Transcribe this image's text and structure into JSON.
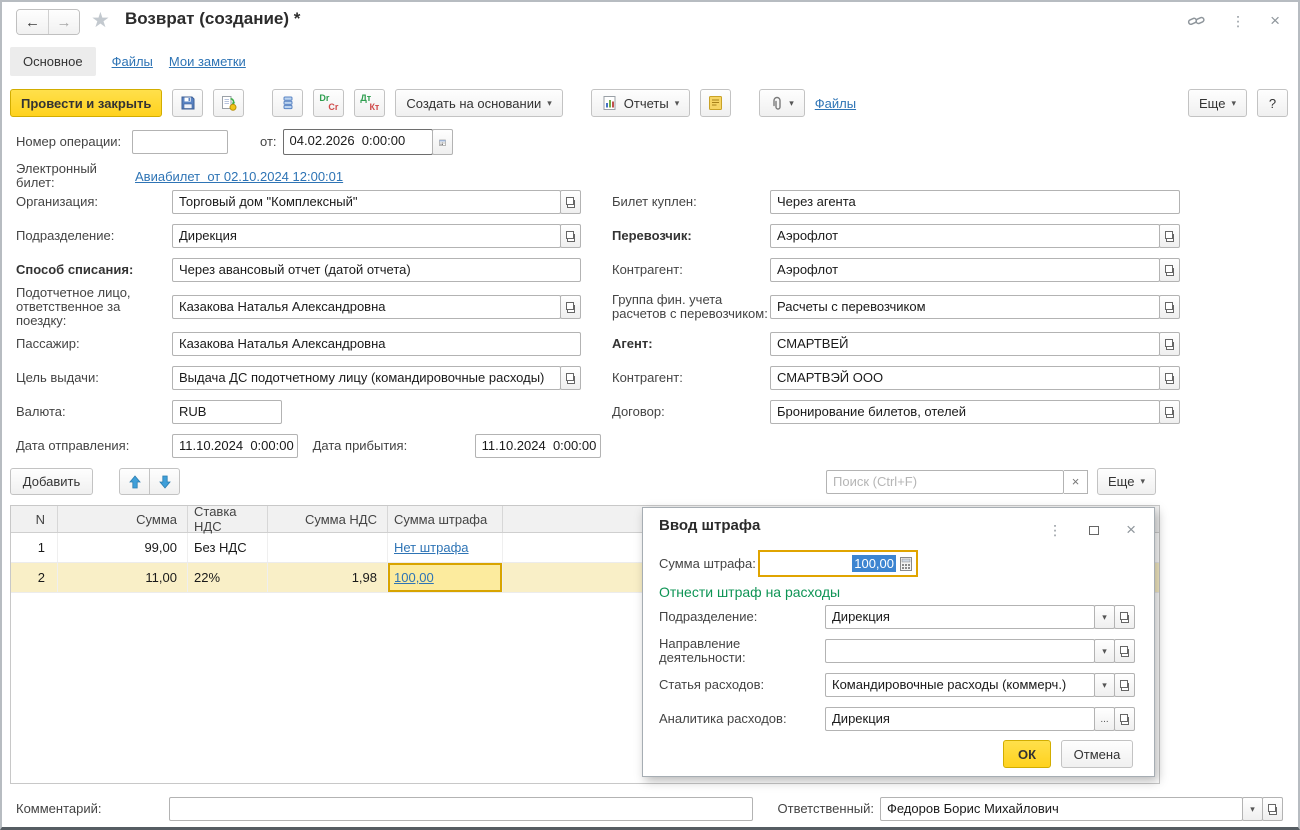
{
  "palette": {
    "accent_yellow": "#ffd21e",
    "link_blue": "#2e74b5",
    "selected_row": "#f9efc7",
    "active_cell_border": "#d8a400",
    "section_green": "#0e9455",
    "selection_blue": "#3d85d1"
  },
  "icons": {
    "back-icon": "←",
    "forward-icon": "→",
    "favorite-icon": "★",
    "link-chain-icon": "css-svg",
    "more-dots-icon": "⋮",
    "close-icon": "×",
    "save-icon": "floppy-svg",
    "post-document-icon": "doc-arrow-svg",
    "register-icon": "stack-svg",
    "reports-icon": "chart-svg",
    "note-icon": "yellow-doc-svg",
    "attach-icon": "paperclip-svg",
    "calendar-icon": "calendar-svg",
    "calculator-icon": "calc-svg",
    "chevron-down-icon": "▾",
    "open-icon": "two-squares",
    "arrow-up-icon": "blue-arrow-svg",
    "arrow-down-icon": "blue-arrow-svg",
    "maximize-icon": "square",
    "clear-icon": "×"
  },
  "header": {
    "title": "Возврат (создание) *"
  },
  "tabs": {
    "main": "Основное",
    "files": "Файлы",
    "notes": "Мои заметки"
  },
  "toolbar": {
    "post_and_close": "Провести и закрыть",
    "dr": "Dr",
    "cr": "Cr",
    "dt": "Дт",
    "kt": "Кт",
    "create_on_basis": "Создать на основании",
    "reports": "Отчеты",
    "files_link": "Файлы",
    "more": "Еще",
    "help": "?"
  },
  "doc": {
    "number_label": "Номер операции:",
    "number_value": "",
    "date_label": "от:",
    "date_value": "04.02.2026  0:00:00",
    "eticket_label": "Электронный билет:",
    "eticket_link": "Авиабилет  от 02.10.2024 12:00:01"
  },
  "form_left": {
    "org": {
      "label": "Организация:",
      "value": "Торговый дом \"Комплексный\""
    },
    "division": {
      "label": "Подразделение:",
      "value": "Дирекция"
    },
    "writeoff": {
      "label": "Способ списания:",
      "value": "Через авансовый отчет (датой отчета)"
    },
    "person": {
      "label": "Подотчетное лицо, ответственное за поездку:",
      "value": "Казакова Наталья Александровна"
    },
    "passenger": {
      "label": "Пассажир:",
      "value": "Казакова Наталья Александровна"
    },
    "purpose": {
      "label": "Цель выдачи:",
      "value": "Выдача ДС подотчетному лицу (командировочные расходы)"
    },
    "currency": {
      "label": "Валюта:",
      "value": "RUB"
    },
    "depart": {
      "label": "Дата отправления:",
      "value": "11.10.2024  0:00:00"
    },
    "arrive": {
      "label": "Дата прибытия:",
      "value": "11.10.2024  0:00:00"
    }
  },
  "form_right": {
    "bought": {
      "label": "Билет куплен:",
      "value": "Через агента"
    },
    "carrier": {
      "label": "Перевозчик:",
      "value": "Аэрофлот"
    },
    "carrier_contractor": {
      "label": "Контрагент:",
      "value": "Аэрофлот"
    },
    "fin_group": {
      "label": "Группа фин. учета расчетов с перевозчиком:",
      "value": "Расчеты с перевозчиком"
    },
    "agent": {
      "label": "Агент:",
      "value": "СМАРТВЕЙ"
    },
    "agent_contractor": {
      "label": "Контрагент:",
      "value": "СМАРТВЭЙ ООО"
    },
    "contract": {
      "label": "Договор:",
      "value": "Бронирование билетов, отелей"
    }
  },
  "table": {
    "add_button": "Добавить",
    "search_placeholder": "Поиск (Ctrl+F)",
    "more_button": "Еще",
    "headers": [
      "N",
      "Сумма",
      "Ставка НДС",
      "Сумма НДС",
      "Сумма штрафа",
      ""
    ],
    "rows": [
      {
        "n": "1",
        "sum": "99,00",
        "vat_rate": "Без НДС",
        "vat_sum": "",
        "penalty": "Нет штрафа"
      },
      {
        "n": "2",
        "sum": "11,00",
        "vat_rate": "22%",
        "vat_sum": "1,98",
        "penalty": "100,00"
      }
    ]
  },
  "dialog": {
    "title": "Ввод штрафа",
    "penalty_label": "Сумма штрафа:",
    "penalty_value": "100,00",
    "section_header": "Отнести штраф на расходы",
    "fields": {
      "division": {
        "label": "Подразделение:",
        "value": "Дирекция"
      },
      "activity": {
        "label": "Направление деятельности:",
        "value": ""
      },
      "expense_item": {
        "label": "Статья расходов:",
        "value": "Командировочные расходы (коммерч.)"
      },
      "analytics": {
        "label": "Аналитика расходов:",
        "value": "Дирекция",
        "ellipsis_button": "..."
      }
    },
    "ok": "ОК",
    "cancel": "Отмена"
  },
  "footer": {
    "comment_label": "Комментарий:",
    "comment_value": "",
    "responsible_label": "Ответственный:",
    "responsible_value": "Федоров Борис Михайлович"
  }
}
